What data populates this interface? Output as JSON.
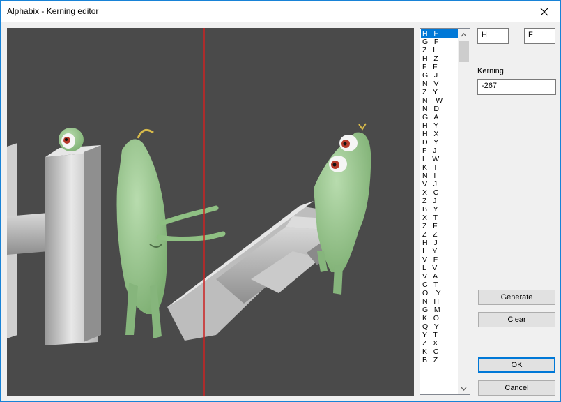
{
  "window": {
    "title": "Alphabix - Kerning editor"
  },
  "pairs": [
    "H   F",
    "G   F",
    "Z   I",
    "H   Z",
    "F   F",
    "G   J",
    "N   V",
    "Z   Y",
    "N    W",
    "N   D",
    "G   A",
    "H   Y",
    "H   X",
    "D   Y",
    "F   J",
    "L   W",
    "K   T",
    "N   I",
    "V   J",
    "X   C",
    "Z   J",
    "B   Y",
    "X   T",
    "Z   F",
    "Z   Z",
    "H   J",
    "I    Y",
    "V   F",
    "L   V",
    "V   A",
    "C   T",
    "O    Y",
    "N   H",
    "G   M",
    "K   O",
    "Q   Y",
    "Y   T",
    "Z   X",
    "K   C",
    "B   Z"
  ],
  "selected_pair_index": 0,
  "editor": {
    "left_char": "H",
    "right_char": "F",
    "kerning_label": "Kerning",
    "kerning_value": "-267"
  },
  "buttons": {
    "generate": "Generate",
    "clear": "Clear",
    "ok": "OK",
    "cancel": "Cancel"
  },
  "colors": {
    "viewport_bg": "#4a4a4a",
    "guide_line": "#cc2222",
    "selection": "#0078d7",
    "accent_border": "#1883d7"
  }
}
